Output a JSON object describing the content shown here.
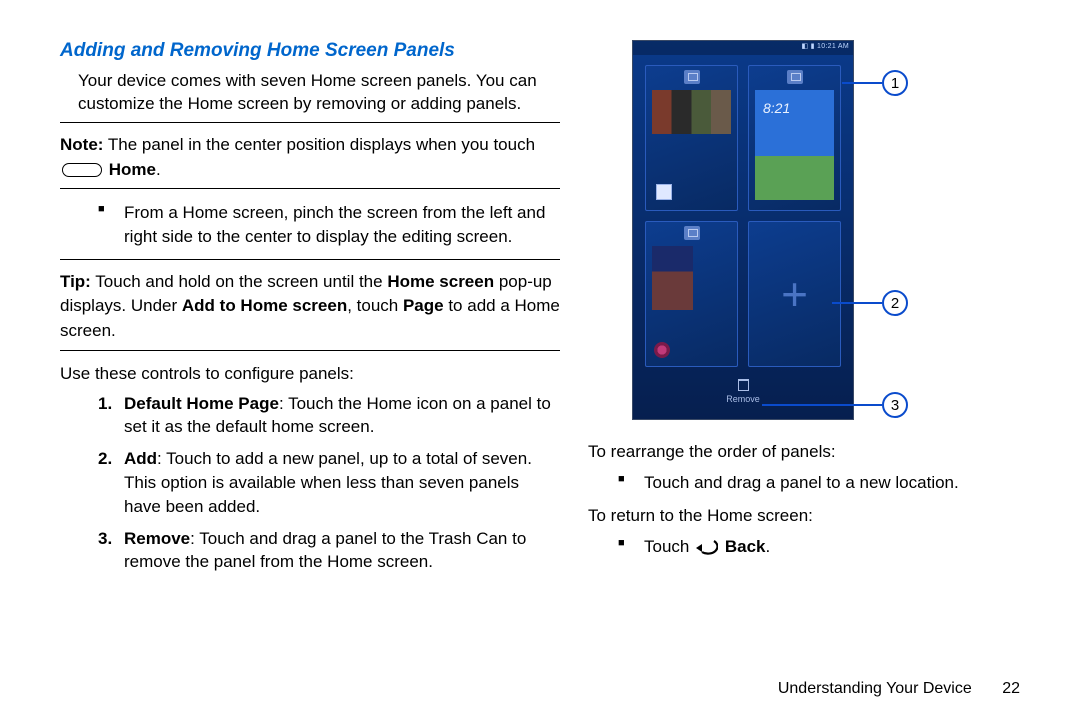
{
  "section": {
    "title": "Adding and Removing Home Screen Panels",
    "intro": "Your device comes with seven Home screen panels. You can customize the Home screen by removing or adding panels."
  },
  "note": {
    "prefix": "Note:",
    "text_before": "The panel in the center position displays when you touch",
    "home_label": "Home",
    "text_after": "."
  },
  "pinch_bullet": "From a Home screen, pinch the screen from the left and right side to the center to display the editing screen.",
  "tip": {
    "prefix": "Tip:",
    "part1": "Touch and hold on the screen until the ",
    "bold1": "Home screen",
    "part2": " pop-up displays. Under ",
    "bold2": "Add to Home screen",
    "part3": ", touch ",
    "bold3": "Page",
    "part4": " to add a Home screen."
  },
  "controls_intro": "Use these controls to configure panels:",
  "controls": [
    {
      "num": "1.",
      "lead": "Default Home Page",
      "text": ": Touch the Home icon on a panel to set it as the default home screen."
    },
    {
      "num": "2.",
      "lead": "Add",
      "text": ": Touch to add a new panel, up to a total of seven. This option is available when less than seven panels have been added."
    },
    {
      "num": "3.",
      "lead": "Remove",
      "text": ": Touch and drag a panel to the Trash Can to remove the panel from the Home screen."
    }
  ],
  "rearrange": {
    "heading": "To rearrange the order of panels:",
    "bullet": "Touch and drag a panel to a new location."
  },
  "return": {
    "heading": "To return to the Home screen:",
    "touch": "Touch",
    "back": "Back",
    "period": "."
  },
  "phone": {
    "status_time": "10:21 AM",
    "panel2_clock": "8:21",
    "remove_label": "Remove"
  },
  "callouts": {
    "c1": "1",
    "c2": "2",
    "c3": "3"
  },
  "footer": {
    "chapter": "Understanding Your Device",
    "page": "22"
  }
}
